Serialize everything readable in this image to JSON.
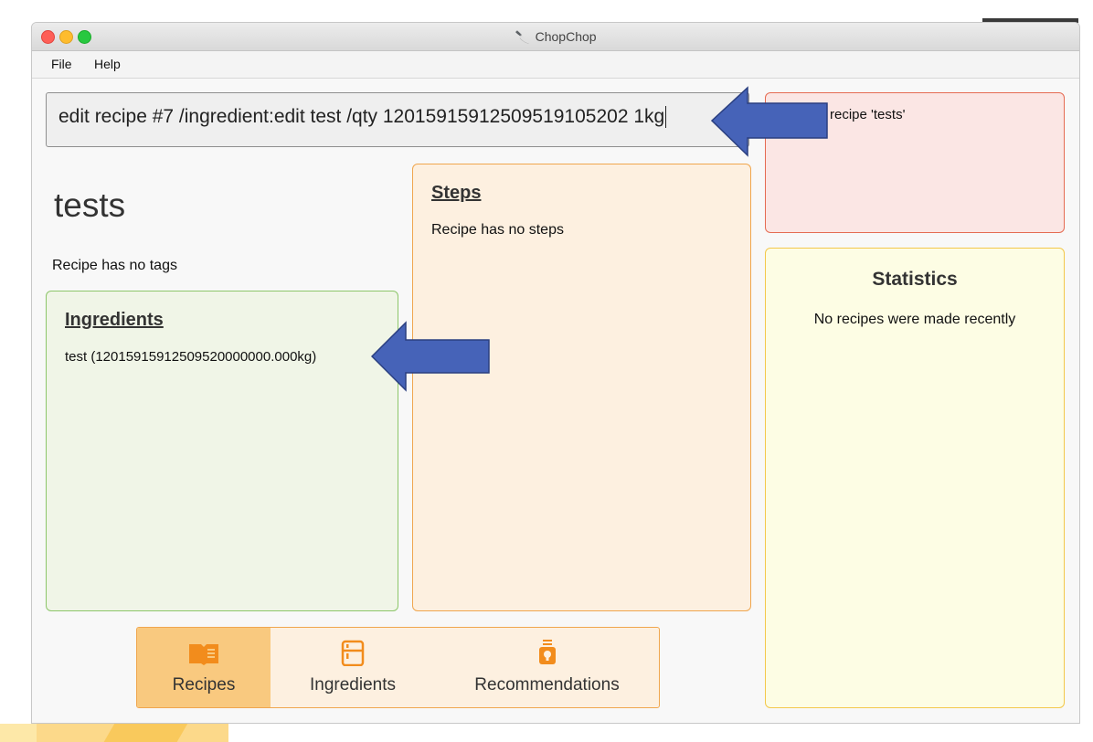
{
  "window": {
    "title": "ChopChop"
  },
  "menu": {
    "file": "File",
    "help": "Help"
  },
  "command": {
    "value": "edit recipe #7 /ingredient:edit test /qty 12015915912509519105202 1kg"
  },
  "result": {
    "message": "recipe 'tests'"
  },
  "recipe": {
    "name": "tests",
    "tags_text": "Recipe has no tags",
    "ingredients_header": "Ingredients",
    "ingredients": [
      "test (12015915912509520000000.000kg)"
    ],
    "steps_header": "Steps",
    "steps_empty": "Recipe has no steps"
  },
  "statistics": {
    "title": "Statistics",
    "empty": "No recipes were made recently"
  },
  "tabs": [
    {
      "label": "Recipes",
      "icon": "book-icon",
      "active": true
    },
    {
      "label": "Ingredients",
      "icon": "fridge-icon",
      "active": false
    },
    {
      "label": "Recommendations",
      "icon": "jar-icon",
      "active": false
    }
  ],
  "colors": {
    "accent_orange": "#f0a64e",
    "tab_active": "#f9c97f",
    "icon_orange": "#f28c1c",
    "annotation_arrow": "#4663b8"
  }
}
